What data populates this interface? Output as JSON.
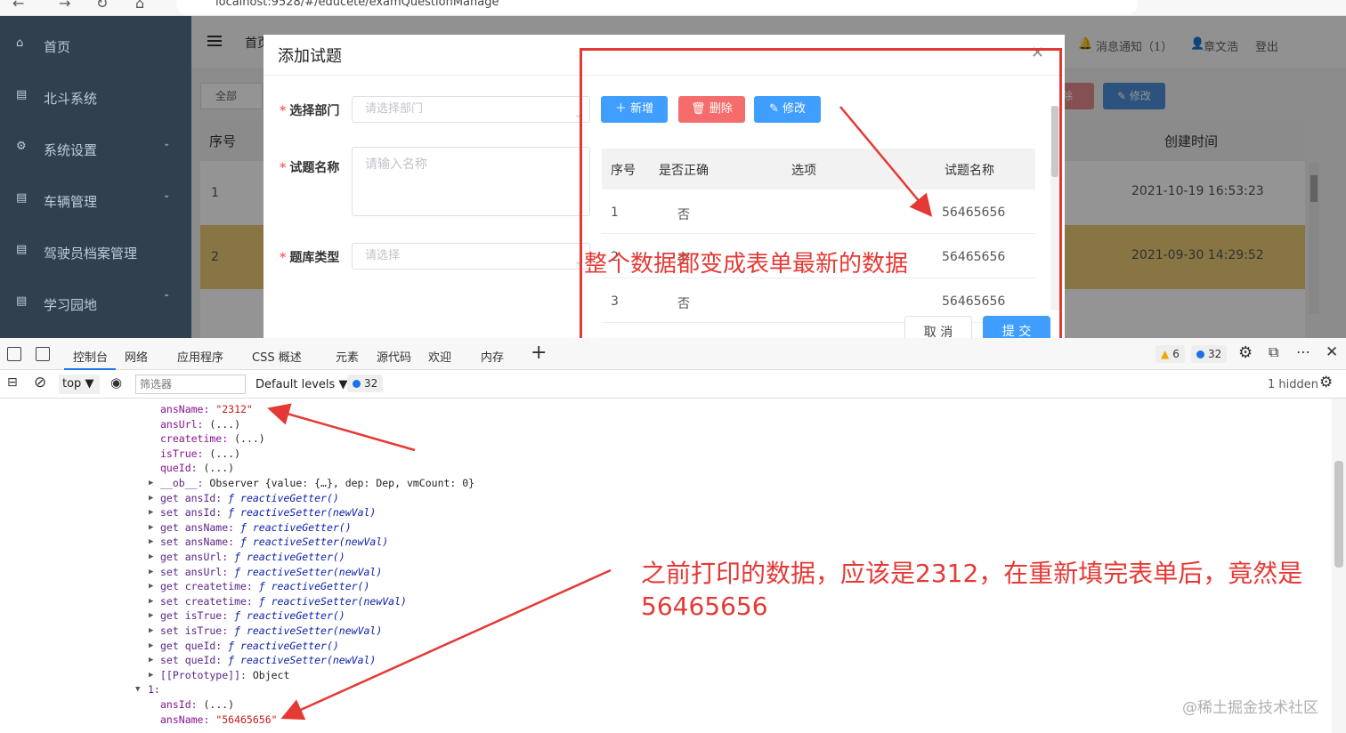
{
  "browser": {
    "url": "localhost:9528/#/educete/examQuestionManage"
  },
  "sidebar": {
    "items": [
      {
        "label": "首页",
        "icon": "home-icon"
      },
      {
        "label": "北斗系统",
        "icon": "document-icon"
      },
      {
        "label": "系统设置",
        "icon": "gear-icon"
      },
      {
        "label": "车辆管理",
        "icon": "document-icon"
      },
      {
        "label": "驾驶员档案管理",
        "icon": "document-icon"
      },
      {
        "label": "学习园地",
        "icon": "document-icon"
      }
    ]
  },
  "header": {
    "breadcrumb": "首页",
    "notice": "消息通知（1）",
    "user": "章文浩",
    "logout": "登出"
  },
  "toolbar": {
    "all": "全部",
    "delete": "除",
    "edit": "修改"
  },
  "bg_table": {
    "col_index": "序号",
    "col_created": "创建时间",
    "rows": [
      {
        "index": "1",
        "created": "2021-10-19 16:53:23"
      },
      {
        "index": "2",
        "created": "2021-09-30 14:29:52"
      }
    ]
  },
  "dialog": {
    "title": "添加试题",
    "fields": {
      "dept_label": "选择部门",
      "dept_placeholder": "请选择部门",
      "name_label": "试题名称",
      "name_placeholder": "请输入名称",
      "type_label": "题库类型",
      "type_placeholder": "请选择"
    },
    "buttons": {
      "add": "新增",
      "delete": "删除",
      "edit": "修改",
      "cancel": "取 消",
      "submit": "提 交"
    },
    "answer_table": {
      "headers": [
        "序号",
        "是否正确",
        "选项",
        "试题名称"
      ],
      "rows": [
        {
          "index": "1",
          "correct": "否",
          "option": "",
          "name": "56465656"
        },
        {
          "index": "2",
          "correct": "否",
          "option": "",
          "name": "56465656"
        },
        {
          "index": "3",
          "correct": "否",
          "option": "",
          "name": "56465656"
        }
      ]
    }
  },
  "annotations": {
    "top": "整个数据都变成表单最新的数据",
    "bottom": "之前打印的数据，应该是2312，在重新填完表单后，竟然是56465656",
    "color": "#e53935"
  },
  "devtools": {
    "tabs": [
      "控制台",
      "网络",
      "应用程序",
      "CSS 概述",
      "元素",
      "源代码",
      "欢迎",
      "内存"
    ],
    "warnings": "6",
    "messages": "32",
    "context": "top",
    "filter_placeholder": "筛选器",
    "levels": "Default levels",
    "issues": "32",
    "hidden": "1 hidden",
    "console_lines": [
      {
        "indent": 0,
        "k": "ansName",
        "v": "\"2312\"",
        "type": "str"
      },
      {
        "indent": 0,
        "k": "ansUrl",
        "v": "(...)",
        "type": "plain"
      },
      {
        "indent": 0,
        "k": "createtime",
        "v": "(...)",
        "type": "plain"
      },
      {
        "indent": 0,
        "k": "isTrue",
        "v": "(...)",
        "type": "plain"
      },
      {
        "indent": 0,
        "k": "queId",
        "v": "(...)",
        "type": "plain"
      },
      {
        "indent": 1,
        "k": "__ob__",
        "v": "Observer {value: {…}, dep: Dep, vmCount: 0}",
        "type": "obj"
      },
      {
        "indent": 1,
        "k": "get ansId",
        "v": "ƒ reactiveGetter()",
        "type": "fn"
      },
      {
        "indent": 1,
        "k": "set ansId",
        "v": "ƒ reactiveSetter(newVal)",
        "type": "fn"
      },
      {
        "indent": 1,
        "k": "get ansName",
        "v": "ƒ reactiveGetter()",
        "type": "fn"
      },
      {
        "indent": 1,
        "k": "set ansName",
        "v": "ƒ reactiveSetter(newVal)",
        "type": "fn"
      },
      {
        "indent": 1,
        "k": "get ansUrl",
        "v": "ƒ reactiveGetter()",
        "type": "fn"
      },
      {
        "indent": 1,
        "k": "set ansUrl",
        "v": "ƒ reactiveSetter(newVal)",
        "type": "fn"
      },
      {
        "indent": 1,
        "k": "get createtime",
        "v": "ƒ reactiveGetter()",
        "type": "fn"
      },
      {
        "indent": 1,
        "k": "set createtime",
        "v": "ƒ reactiveSetter(newVal)",
        "type": "fn"
      },
      {
        "indent": 1,
        "k": "get isTrue",
        "v": "ƒ reactiveGetter()",
        "type": "fn"
      },
      {
        "indent": 1,
        "k": "set isTrue",
        "v": "ƒ reactiveSetter(newVal)",
        "type": "fn"
      },
      {
        "indent": 1,
        "k": "get queId",
        "v": "ƒ reactiveGetter()",
        "type": "fn"
      },
      {
        "indent": 1,
        "k": "set queId",
        "v": "ƒ reactiveSetter(newVal)",
        "type": "fn"
      },
      {
        "indent": 1,
        "k": "[[Prototype]]",
        "v": "Object",
        "type": "proto"
      },
      {
        "indent": 2,
        "k": "1",
        "v": "",
        "type": "open"
      },
      {
        "indent": 0,
        "k": "ansId",
        "v": "(...)",
        "type": "plain"
      },
      {
        "indent": 0,
        "k": "ansName",
        "v": "\"56465656\"",
        "type": "str"
      }
    ]
  },
  "watermark": "@稀土掘金技术社区"
}
